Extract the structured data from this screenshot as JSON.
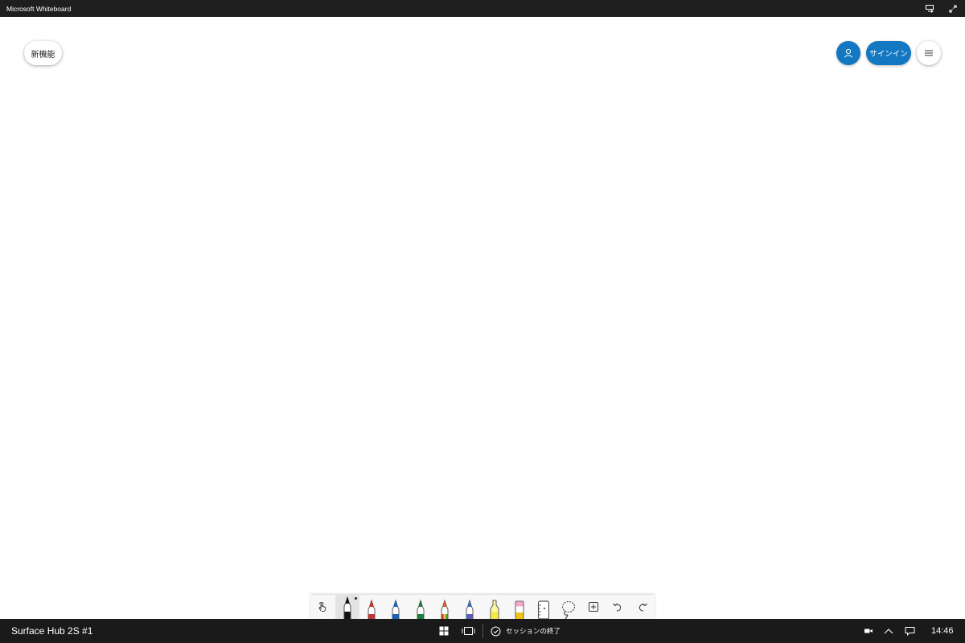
{
  "window": {
    "title": "Microsoft Whiteboard"
  },
  "header": {
    "whats_new_label": "新機能",
    "sign_in_label": "サインイン"
  },
  "toolbar": {
    "tools": [
      {
        "name": "touch-pan-tool",
        "icon": "hand-touch-icon"
      },
      {
        "name": "pen-black",
        "icon": "pen-icon",
        "color": "#111111",
        "selected": true
      },
      {
        "name": "pen-red",
        "icon": "pen-icon",
        "color": "#d32f2f"
      },
      {
        "name": "pen-blue",
        "icon": "pen-icon",
        "color": "#1565c0"
      },
      {
        "name": "pen-green",
        "icon": "pen-icon",
        "color": "#1b7f3b"
      },
      {
        "name": "pen-rainbow",
        "icon": "pen-icon",
        "color": "#e6532e"
      },
      {
        "name": "pen-galaxy",
        "icon": "pen-icon",
        "color": "#3a6fc4"
      },
      {
        "name": "highlighter",
        "icon": "highlighter-icon",
        "color": "#f5e94a"
      },
      {
        "name": "eraser",
        "icon": "eraser-icon",
        "color": "#f2a6c8"
      },
      {
        "name": "ruler",
        "icon": "ruler-icon"
      },
      {
        "name": "lasso-select",
        "icon": "lasso-icon"
      },
      {
        "name": "insert",
        "icon": "plus-box-icon"
      },
      {
        "name": "undo",
        "icon": "undo-icon"
      },
      {
        "name": "redo",
        "icon": "redo-icon"
      }
    ]
  },
  "taskbar": {
    "device_name": "Surface Hub 2S #1",
    "end_session_label": "セッションの終了",
    "time": "14:46"
  }
}
